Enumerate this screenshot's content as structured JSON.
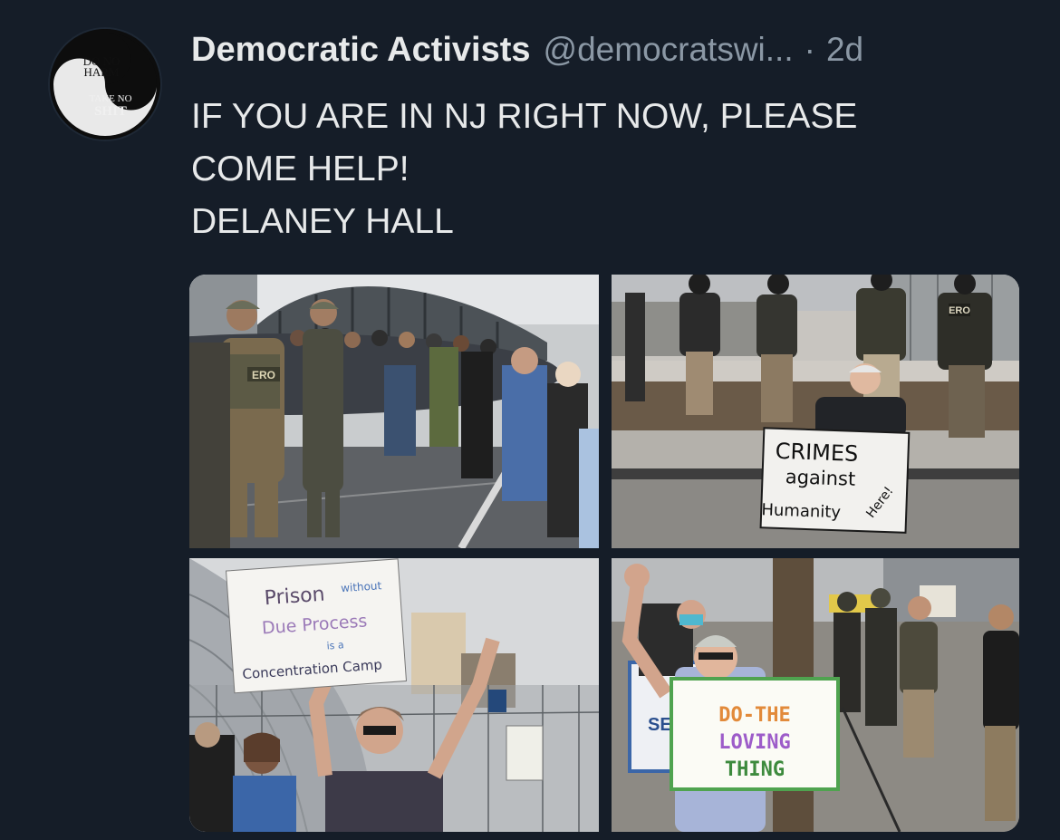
{
  "tweet": {
    "avatar": {
      "icon": "yin-yang-logo",
      "top_text": [
        "DO NO",
        "HARM"
      ],
      "bottom_text": [
        "TAKE NO",
        "SHIT"
      ]
    },
    "author_name": "Democratic Activists",
    "handle": "@democratswi...",
    "separator": "·",
    "time_ago": "2d",
    "text_lines": [
      "IF YOU ARE IN NJ RIGHT NOW, PLEASE",
      "COME HELP!",
      "DELANEY HALL"
    ]
  },
  "media": {
    "photos": [
      {
        "vest_label": "ERO"
      },
      {
        "vest_label": "ERO",
        "sign_lines": [
          "CRIMES",
          "against",
          "Humanity",
          "Here!"
        ]
      },
      {
        "sign_lines": [
          "Prison",
          "without",
          "Due Process",
          "is a",
          "Concentration Camp"
        ]
      },
      {
        "sign_lines": [
          "DO-THE",
          "LOVING",
          "THING"
        ],
        "banner_text": "SEP"
      }
    ]
  }
}
